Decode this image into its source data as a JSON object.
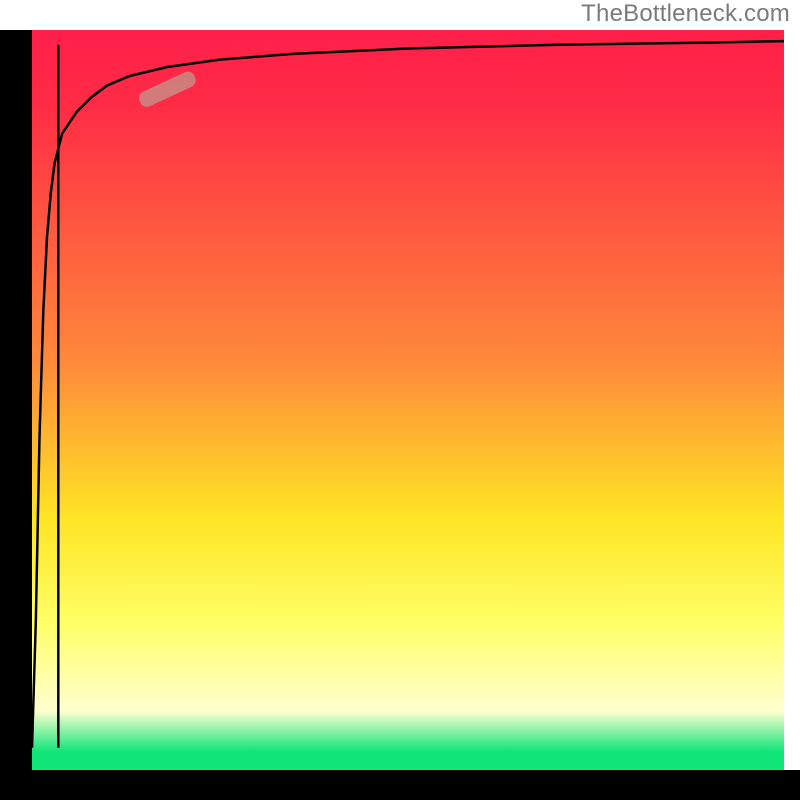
{
  "watermark": {
    "text": "TheBottleneck.com"
  },
  "colors": {
    "top": "#ff1f4a",
    "red": "#ff2b45",
    "orange": "#ff8a3a",
    "yellow": "#ffe524",
    "paleyellow": "#ffff66",
    "nearwhite": "#ffffd0",
    "green": "#11e57a",
    "curve": "#000000",
    "marker": "#c98a84"
  },
  "chart_data": {
    "type": "line",
    "title": "",
    "xlabel": "",
    "ylabel": "",
    "xlim": [
      0,
      100
    ],
    "ylim": [
      0,
      100
    ],
    "grid": false,
    "legend": false,
    "series": [
      {
        "name": "bottleneck-curve",
        "x": [
          0,
          0.5,
          1,
          1.5,
          2,
          2.5,
          3,
          4,
          6,
          8,
          10,
          13,
          18,
          25,
          35,
          50,
          70,
          90,
          100
        ],
        "y": [
          3,
          20,
          45,
          62,
          72,
          78,
          82,
          86,
          89,
          91,
          92.5,
          93.8,
          95,
          96,
          96.8,
          97.5,
          98,
          98.3,
          98.5
        ]
      },
      {
        "name": "left-spike",
        "x": [
          3.5,
          3.5
        ],
        "y": [
          3,
          98
        ]
      }
    ],
    "marker": {
      "name": "highlight-segment",
      "x_center": 18,
      "y_center": 92,
      "angle_deg": 25,
      "length": 8
    },
    "gradient_stops": [
      {
        "pos": 0.0,
        "color": "#ff1f4a"
      },
      {
        "pos": 0.1,
        "color": "#ff2b45"
      },
      {
        "pos": 0.45,
        "color": "#ff8a3a"
      },
      {
        "pos": 0.66,
        "color": "#ffe524"
      },
      {
        "pos": 0.8,
        "color": "#ffff66"
      },
      {
        "pos": 0.92,
        "color": "#ffffd0"
      },
      {
        "pos": 0.975,
        "color": "#11e57a"
      },
      {
        "pos": 1.0,
        "color": "#11e57a"
      }
    ]
  }
}
